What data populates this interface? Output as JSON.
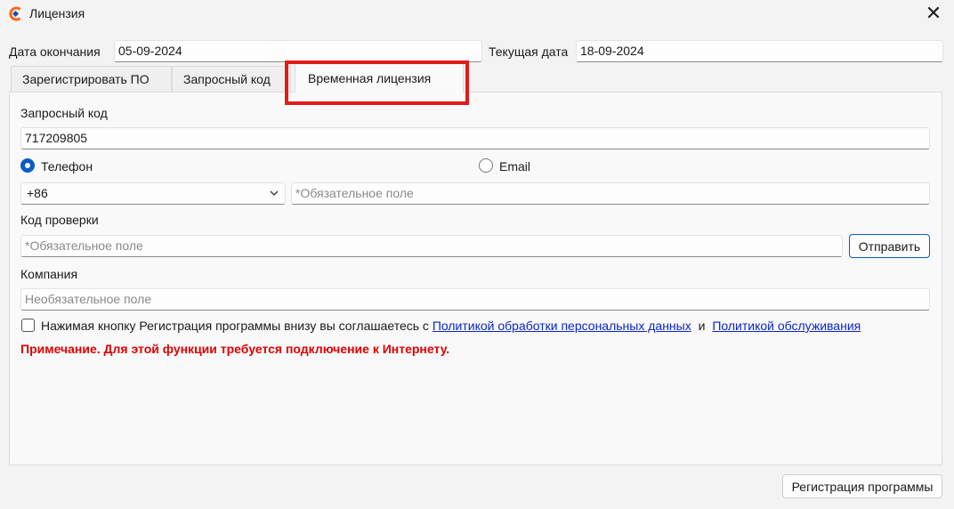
{
  "window": {
    "title": "Лицензия",
    "close_glyph": "✕",
    "accent_colors": {
      "logo_orange": "#f26a1b",
      "logo_blue": "#1d4fa0"
    }
  },
  "header": {
    "end_date_label": "Дата окончания",
    "end_date_value": "05-09-2024",
    "current_date_label": "Текущая дата",
    "current_date_value": "18-09-2024"
  },
  "tabs": [
    {
      "label": "Зарегистрировать ПО",
      "active": false
    },
    {
      "label": "Запросный код",
      "active": false
    },
    {
      "label": "Временная лицензия",
      "active": true
    }
  ],
  "form": {
    "request_code_label": "Запросный код",
    "request_code_value": "717209805",
    "radio_phone_label": "Телефон",
    "radio_email_label": "Email",
    "selected_contact": "Телефон",
    "country_code": "+86",
    "phone_placeholder": "*Обязательное поле",
    "verification_label": "Код проверки",
    "verification_placeholder": "*Обязательное поле",
    "send_button": "Отправить",
    "company_label": "Компания",
    "company_placeholder": "Необязательное поле",
    "consent_text": "Нажимая кнопку Регистрация программы внизу вы соглашаетесь с",
    "privacy_link": "Политикой обработки персональных данных",
    "and_text": "и",
    "service_link": "Политикой обслуживания",
    "note": "Примечание. Для этой функции требуется подключение к Интернету."
  },
  "footer": {
    "register_button": "Регистрация программы"
  },
  "icons": [
    "app-logo-icon",
    "close-icon",
    "chevron-down-icon"
  ]
}
